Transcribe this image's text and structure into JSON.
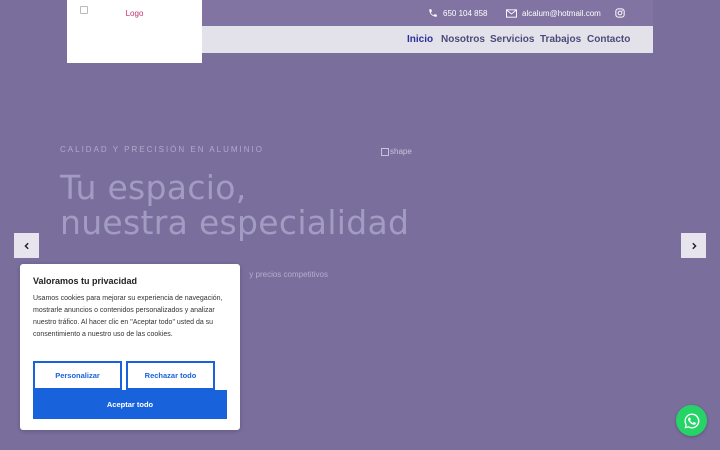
{
  "topbar": {
    "phone": "650 104 858",
    "email": "alcalum@hotmail.com"
  },
  "logo": {
    "alt": "Logo"
  },
  "nav": {
    "items": [
      {
        "label": "Inicio"
      },
      {
        "label": "Nosotros"
      },
      {
        "label": "Servicios"
      },
      {
        "label": "Trabajos"
      },
      {
        "label": "Contacto"
      }
    ]
  },
  "hero": {
    "eyebrow": "CALIDAD Y PRECISIÓN EN ALUMINIO",
    "title_line1": "Tu espacio,",
    "title_line2": "nuestra especialidad",
    "subtitle_visible": "y precios competitivos",
    "shape_alt": "shape"
  },
  "cookie": {
    "title": "Valoramos tu privacidad",
    "text": "Usamos cookies para mejorar su experiencia de navegación, mostrarle anuncios o contenidos personalizados y analizar nuestro tráfico. Al hacer clic en \"Aceptar todo\" usted da su consentimiento a nuestro uso de las cookies.",
    "customize_label": "Personalizar",
    "reject_label": "Rechazar todo",
    "accept_label": "Aceptar todo"
  },
  "icons": {
    "phone": "phone-icon",
    "email": "mail-icon",
    "instagram": "instagram-icon",
    "prev": "chevron-left-icon",
    "next": "chevron-right-icon",
    "whatsapp": "whatsapp-icon"
  },
  "colors": {
    "background": "#7a6e9d",
    "topbar": "#8174a3",
    "navbar": "#e3e2ea",
    "nav_active": "#2b2f9a",
    "accent_button": "#1863dc",
    "whatsapp": "#25d366"
  }
}
